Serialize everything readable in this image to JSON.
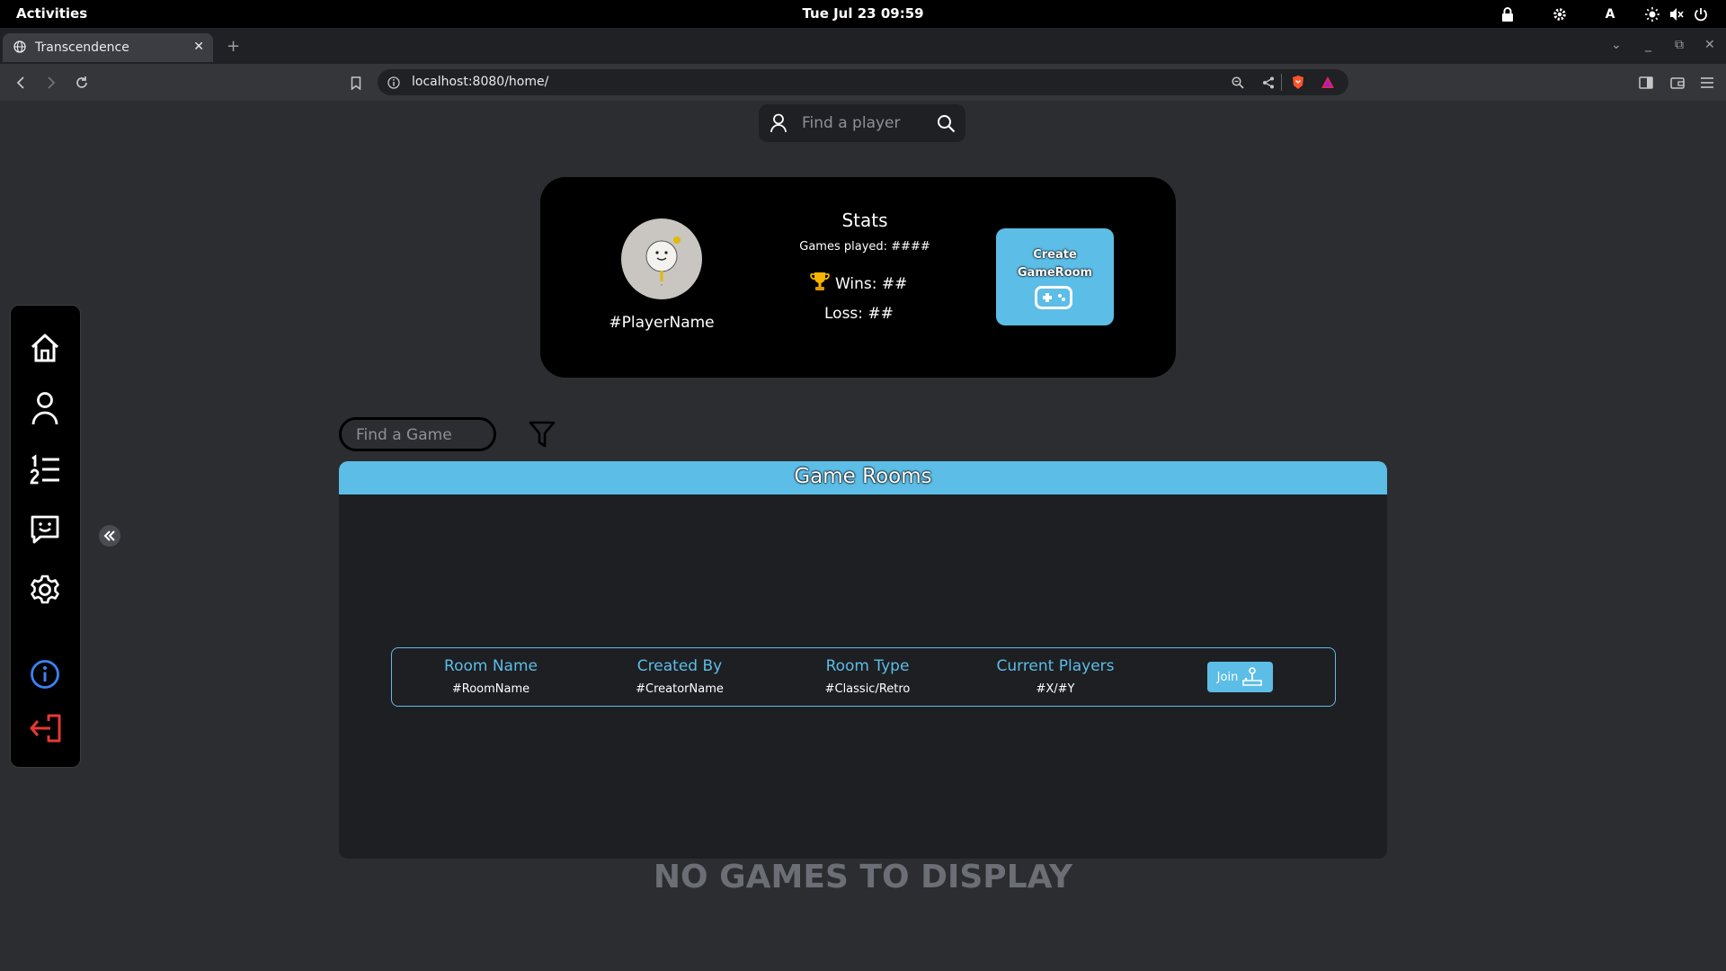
{
  "system_bar": {
    "activities": "Activities",
    "datetime": "Tue Jul 23  09:59",
    "input_method": "A"
  },
  "browser": {
    "tab_title": "Transcendence",
    "url": "localhost:8080/home/"
  },
  "player_search": {
    "placeholder": "Find a player"
  },
  "profile": {
    "player_name": "#PlayerName",
    "stats_title": "Stats",
    "games_played": "Games played: ####",
    "wins": "Wins: ##",
    "loss": "Loss: ##",
    "create_room_line1": "Create",
    "create_room_line2": "GameRoom"
  },
  "sidebar": {
    "items": [
      {
        "name": "home",
        "icon": "home-icon"
      },
      {
        "name": "profile",
        "icon": "user-icon"
      },
      {
        "name": "leaderboard",
        "icon": "ranking-list-icon"
      },
      {
        "name": "chat",
        "icon": "chat-icon"
      },
      {
        "name": "settings",
        "icon": "gear-icon"
      },
      {
        "name": "info",
        "icon": "info-icon"
      },
      {
        "name": "logout",
        "icon": "logout-icon"
      }
    ]
  },
  "game_search": {
    "placeholder": "Find a Game"
  },
  "game_rooms": {
    "title": "Game Rooms",
    "columns": [
      "Room Name",
      "Created By",
      "Room Type",
      "Current Players"
    ],
    "row": [
      "#RoomName",
      "#CreatorName",
      "#Classic/Retro",
      "#X/#Y"
    ],
    "join_label": "Join"
  },
  "empty_message": "NO GAMES TO DISPLAY",
  "colors": {
    "accent": "#5cbde6",
    "background": "#2b2d31",
    "card": "#000000",
    "logout": "#e53935",
    "info": "#3b82f6"
  }
}
